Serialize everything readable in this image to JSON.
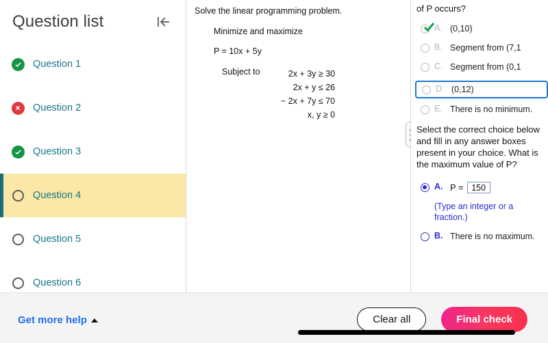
{
  "sidebar": {
    "title": "Question list",
    "collapse_icon": "collapse-left-icon",
    "items": [
      {
        "label": "Question 1",
        "status": "correct",
        "active": false
      },
      {
        "label": "Question 2",
        "status": "incorrect",
        "active": false
      },
      {
        "label": "Question 3",
        "status": "correct",
        "active": false
      },
      {
        "label": "Question 4",
        "status": "unanswered",
        "active": true
      },
      {
        "label": "Question 5",
        "status": "unanswered",
        "active": false
      },
      {
        "label": "Question 6",
        "status": "unanswered",
        "active": false
      }
    ]
  },
  "problem": {
    "title": "Solve the linear programming problem.",
    "objective_label": "Minimize and maximize",
    "objective": "P = 10x + 5y",
    "subject_label": "Subject to",
    "constraints": [
      "2x + 3y  ≥  30",
      "2x + y  ≤  26",
      "− 2x + 7y  ≤  70",
      "x, y  ≥  0"
    ]
  },
  "splitter": {
    "name": "panel-resize-handle"
  },
  "answers": {
    "question1_text": "of P occurs?",
    "options1": [
      {
        "letter": "A.",
        "text": "(0,10)",
        "selected": false,
        "marked_correct": true,
        "boxed": false
      },
      {
        "letter": "B.",
        "text": "Segment from (7,1",
        "selected": false,
        "marked_correct": false,
        "boxed": false
      },
      {
        "letter": "C.",
        "text": "Segment from (0,1",
        "selected": false,
        "marked_correct": false,
        "boxed": false
      },
      {
        "letter": "D.",
        "text": "(0,12)",
        "selected": false,
        "marked_correct": false,
        "boxed": true
      },
      {
        "letter": "E.",
        "text": "There is no minimum.",
        "selected": false,
        "marked_correct": false,
        "boxed": false
      }
    ],
    "question2_text": "Select the correct choice below and fill in any answer boxes present in your choice. What is the maximum value of P?",
    "options2": [
      {
        "letter": "A.",
        "prefix": "P =",
        "input_value": "150",
        "input_placeholder": "",
        "hint": "(Type an integer or a fraction.)",
        "selected": true
      },
      {
        "letter": "B.",
        "text": "There is no maximum.",
        "selected": false
      }
    ]
  },
  "footer": {
    "help_label": "Get more help",
    "help_caret_icon": "caret-up-icon",
    "clear_label": "Clear all",
    "final_label": "Final check"
  },
  "colors": {
    "accent_teal": "#16788a",
    "active_row": "#fbe8a6",
    "active_bar": "#1a6e7e",
    "correct_green": "#159445",
    "incorrect_red": "#e0393e",
    "link_blue": "#1f6ff0",
    "focus_blue": "#1878c8",
    "hint_blue": "#2a2ad0",
    "final_pink": "#f0248a"
  }
}
